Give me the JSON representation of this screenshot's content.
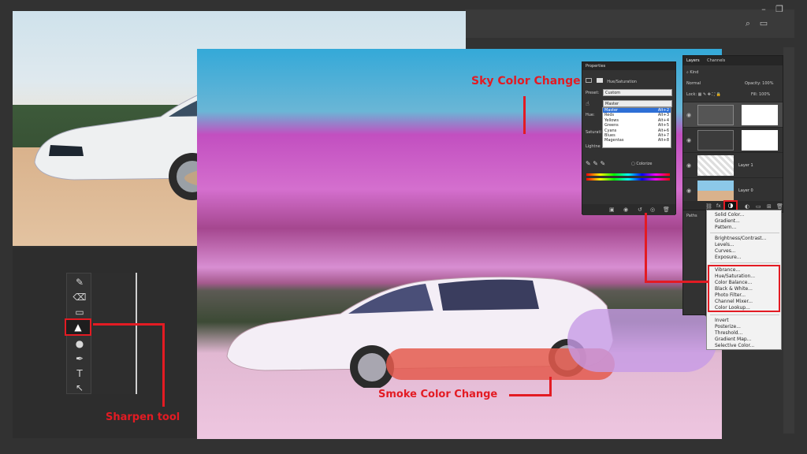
{
  "annotations": {
    "sky": "Sky Color Change",
    "smoke": "Smoke Color Change",
    "sharpen": "Sharpen tool"
  },
  "toolbar": {
    "tools": [
      {
        "icon": "brush-icon",
        "glyph": "✎"
      },
      {
        "icon": "eraser-icon",
        "glyph": "⌫"
      },
      {
        "icon": "gradient-icon",
        "glyph": "▭"
      },
      {
        "icon": "sharpen-icon",
        "glyph": "▲"
      },
      {
        "icon": "dodge-icon",
        "glyph": "●"
      },
      {
        "icon": "pen-icon",
        "glyph": "✒"
      },
      {
        "icon": "type-icon",
        "glyph": "T"
      },
      {
        "icon": "path-select-icon",
        "glyph": "↖"
      }
    ]
  },
  "properties": {
    "title": "Properties",
    "adjustment": "Hue/Saturation",
    "preset_label": "Preset:",
    "preset_value": "Custom",
    "channel_value": "Master",
    "hue_label": "Hue:",
    "saturation_label": "Saturati",
    "lightness_label": "Lightne",
    "colorize_label": "Colorize",
    "channels": [
      {
        "name": "Master",
        "key": "Alt+2"
      },
      {
        "name": "Reds",
        "key": "Alt+3"
      },
      {
        "name": "Yellows",
        "key": "Alt+4"
      },
      {
        "name": "Greens",
        "key": "Alt+5"
      },
      {
        "name": "Cyans",
        "key": "Alt+6"
      },
      {
        "name": "Blues",
        "key": "Alt+7"
      },
      {
        "name": "Magentas",
        "key": "Alt+8"
      }
    ]
  },
  "layers": {
    "tab_layers": "Layers",
    "tab_channels": "Channels",
    "kind_label": "Kind",
    "blend_mode": "Normal",
    "opacity_label": "Opacity:",
    "opacity_value": "100%",
    "lock_label": "Lock:",
    "fill_label": "Fill:",
    "fill_value": "100%",
    "rows": [
      {
        "name": ""
      },
      {
        "name": ""
      },
      {
        "name": "Layer 1"
      },
      {
        "name": "Layer 0"
      }
    ],
    "fx_label": "fx"
  },
  "paths": {
    "label": "Paths"
  },
  "adjustment_menu": {
    "groups": [
      [
        "Solid Color...",
        "Gradient...",
        "Pattern..."
      ],
      [
        "Brightness/Contrast...",
        "Levels...",
        "Curves...",
        "Exposure..."
      ],
      [
        "Vibrance...",
        "Hue/Saturation...",
        "Color Balance...",
        "Black & White...",
        "Photo Filter...",
        "Channel Mixer...",
        "Color Lookup..."
      ],
      [
        "Invert",
        "Posterize...",
        "Threshold...",
        "Gradient Map...",
        "Selective Color..."
      ]
    ]
  },
  "colors": {
    "accent": "#e31b23"
  }
}
